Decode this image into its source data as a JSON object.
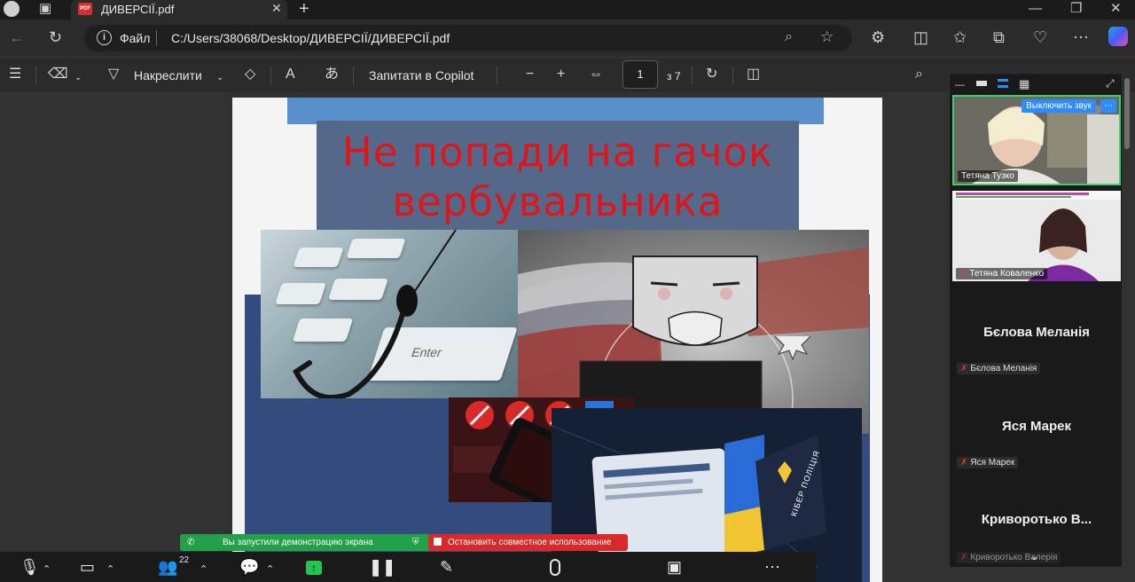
{
  "browser": {
    "tab_title": "ДИВЕРСІЇ.pdf",
    "tab_badge": "PDF",
    "address_scheme": "Файл",
    "address_url": "C:/Users/38068/Desktop/ДИВЕРСІЇ/ДИВЕРСІЇ.pdf"
  },
  "pdf_toolbar": {
    "draw_label": "Накреслити",
    "copilot_label": "Запитати в Copilot",
    "page_current": "1",
    "page_total": "з 7"
  },
  "document": {
    "title_line1": "Не попади на гачок",
    "title_line2": "вербувальника",
    "keyboard_key": "Enter",
    "badge_text": "КІБЕР ПОЛІЦІЯ"
  },
  "meeting": {
    "mute_button": "Выключить звук",
    "participants": [
      {
        "name": "Тетяна Тузко",
        "video": true,
        "muted": false
      },
      {
        "name": "Тетяна  Коваленко",
        "video": true,
        "muted": true
      },
      {
        "name": "Бєлова Меланія",
        "video": false,
        "muted": true
      },
      {
        "name": "Яся Марек",
        "video": false,
        "muted": true
      },
      {
        "name": "Криворотько В...",
        "label": "Криворотько Валерія",
        "video": false,
        "muted": true
      }
    ]
  },
  "zoom_toolbar": {
    "participant_count": "22",
    "share_notice": "Вы запустили демонстрацию экрана",
    "stop_share": "Остановить совместное использование"
  },
  "colors": {
    "title_red": "#e0151a",
    "share_green": "#23a04a",
    "stop_red": "#d82a2a",
    "speaker_border": "#3bd16f",
    "accent_blue": "#2d8cff"
  }
}
